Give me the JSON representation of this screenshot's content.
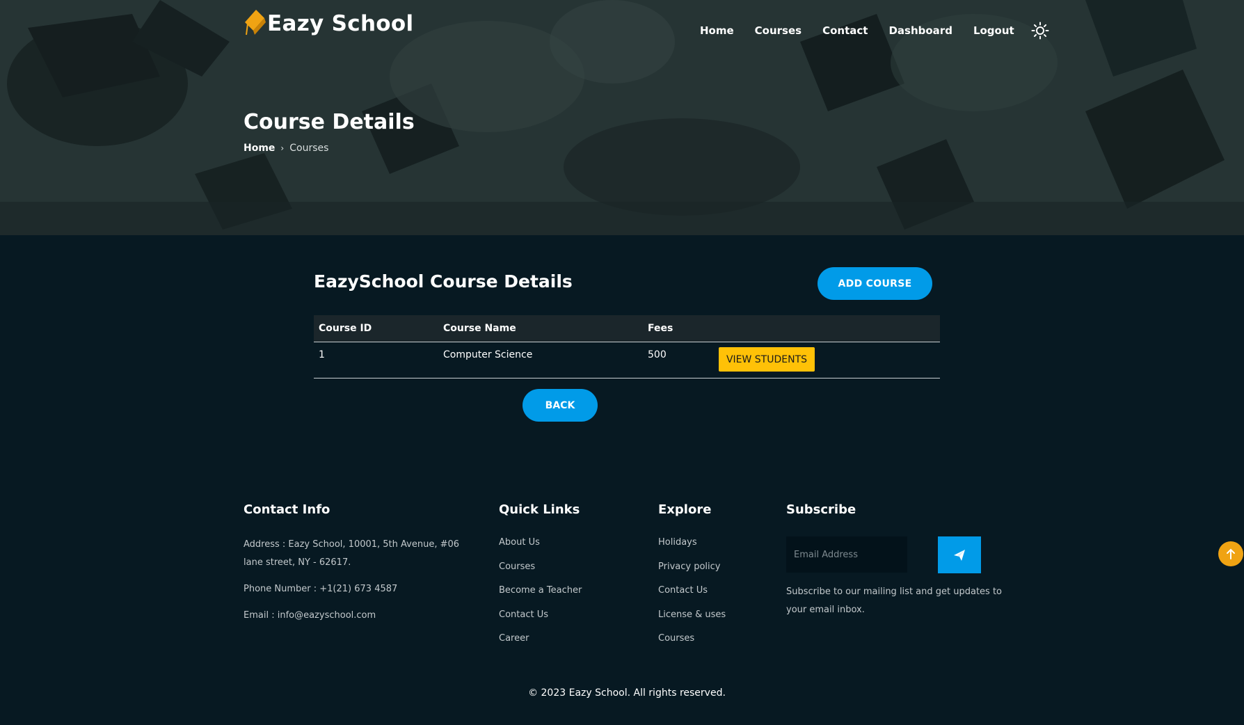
{
  "brand": {
    "name": "Eazy School",
    "logo_color": "#f0a313"
  },
  "nav": {
    "items": [
      "Home",
      "Courses",
      "Contact",
      "Dashboard",
      "Logout"
    ],
    "theme_toggle_icon": "sun-icon"
  },
  "hero": {
    "title": "Course Details",
    "breadcrumb": {
      "home": "Home",
      "separator": "›",
      "current": "Courses"
    }
  },
  "main": {
    "section_title": "EazySchool Course Details",
    "add_course_label": "ADD COURSE",
    "table": {
      "headers": [
        "Course ID",
        "Course Name",
        "Fees"
      ],
      "rows": [
        {
          "id": "1",
          "name": "Computer Science",
          "fees": "500",
          "action": "VIEW STUDENTS"
        }
      ]
    },
    "back_label": "BACK",
    "accent": "#019be8",
    "action_color": "#ffc107"
  },
  "footer": {
    "contact": {
      "title": "Contact Info",
      "address": "Address : Eazy School, 10001, 5th Avenue, #06 lane street, NY - 62617.",
      "phone": "Phone Number : +1(21) 673 4587",
      "email": "Email : info@eazyschool.com"
    },
    "quick_links": {
      "title": "Quick Links",
      "items": [
        "About Us",
        "Courses",
        "Become a Teacher",
        "Contact Us",
        "Career"
      ]
    },
    "explore": {
      "title": "Explore",
      "items": [
        "Holidays",
        "Privacy policy",
        "Contact Us",
        "License & uses",
        "Courses"
      ]
    },
    "subscribe": {
      "title": "Subscribe",
      "placeholder": "Email Address",
      "send_icon": "send-icon",
      "text": "Subscribe to our mailing list and get updates to your email inbox."
    },
    "copyright": "© 2023 Eazy School. All rights reserved."
  },
  "scroll_top_icon": "arrow-up-icon"
}
